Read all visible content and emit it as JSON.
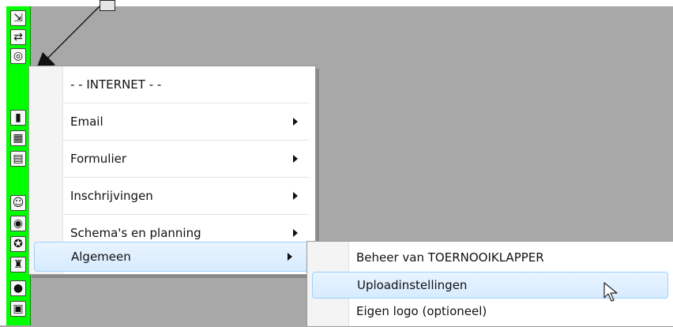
{
  "menu": {
    "items": [
      {
        "label": "- -  INTERNET  - -",
        "has_submenu": false
      },
      {
        "label": "Email",
        "has_submenu": true
      },
      {
        "label": "Formulier",
        "has_submenu": true
      },
      {
        "label": "Inschrijvingen",
        "has_submenu": true
      },
      {
        "label": "Schema's en planning",
        "has_submenu": true
      },
      {
        "label": "Algemeen",
        "has_submenu": true,
        "selected": true
      }
    ]
  },
  "submenu": {
    "parent": "Algemeen",
    "items": [
      {
        "label": "Beheer van TOERNOOIKLAPPER"
      },
      {
        "label": "Uploadinstellingen",
        "hovered": true
      },
      {
        "label": "Eigen logo (optioneel)"
      }
    ]
  },
  "toolbar": {
    "icons": [
      "exit-door-icon",
      "swap-arrows-icon",
      "globe-icon",
      "ruler-icon",
      "calendar-icon",
      "schedule-icon",
      "people-icon",
      "target-icon",
      "award-icon",
      "trophy-icon",
      "coin-icon",
      "document-icon"
    ]
  },
  "colors": {
    "toolbar_green": "#00ff00",
    "desktop_gray": "#a8a8a8",
    "hover_blue": "#d7ebff",
    "hover_border": "#9fd0ff"
  }
}
